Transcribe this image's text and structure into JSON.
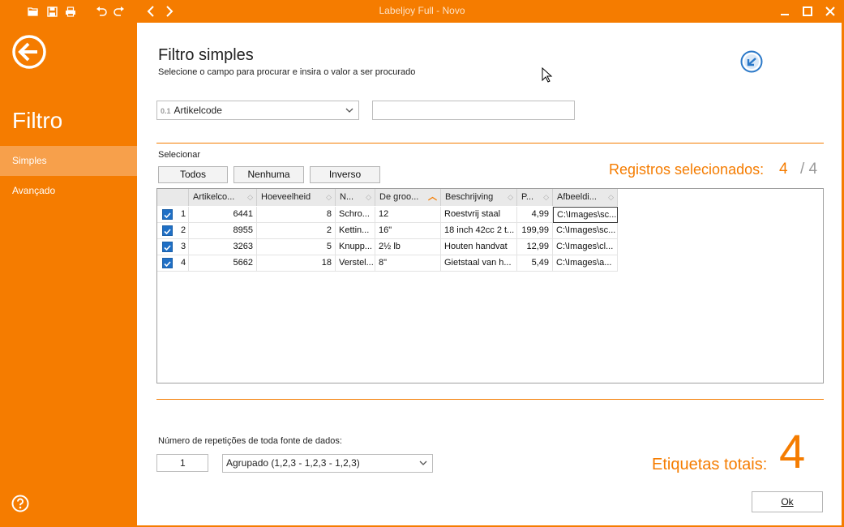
{
  "window": {
    "title": "Labeljoy Full - Novo"
  },
  "toolbar": {
    "icons": [
      "open-folder-icon",
      "save-icon",
      "print-icon",
      "undo-icon",
      "redo-icon",
      "back-icon",
      "forward-icon"
    ]
  },
  "sidebar": {
    "heading": "Filtro",
    "items": [
      {
        "label": "Simples",
        "active": true
      },
      {
        "label": "Avançado",
        "active": false
      }
    ]
  },
  "main": {
    "heading": "Filtro simples",
    "subheading": "Selecione o campo para procurar e insira o valor a ser procurado",
    "field_select": {
      "prefix": "0.1",
      "value": "Artikelcode"
    },
    "search_value": "",
    "select_label": "Selecionar",
    "buttons": {
      "all": "Todos",
      "none": "Nenhuma",
      "inverse": "Inverso"
    },
    "registros_label": "Registros selecionados:",
    "registros_selected": "4",
    "registros_total": "/ 4",
    "columns": [
      "Artikelco...",
      "Hoeveelheid",
      "N...",
      "De groo...",
      "Beschrijving",
      "P...",
      "Afbeeldi..."
    ],
    "rows": [
      {
        "n": "1",
        "code": "6441",
        "qty": "8",
        "name": "Schro...",
        "size": "12",
        "desc": "Roestvrij staal",
        "price": "4,99",
        "img": "C:\\Images\\sc...",
        "checked": true
      },
      {
        "n": "2",
        "code": "8955",
        "qty": "2",
        "name": "Kettin...",
        "size": "16\"",
        "desc": "18 inch 42cc 2 t...",
        "price": "199,99",
        "img": "C:\\Images\\sc...",
        "checked": true
      },
      {
        "n": "3",
        "code": "3263",
        "qty": "5",
        "name": "Knupp...",
        "size": "2½ lb",
        "desc": "Houten handvat",
        "price": "12,99",
        "img": "C:\\Images\\cl...",
        "checked": true
      },
      {
        "n": "4",
        "code": "5662",
        "qty": "18",
        "name": "Verstel...",
        "size": "8\"",
        "desc": "Gietstaal van h...",
        "price": "5,49",
        "img": "C:\\Images\\a...",
        "checked": true
      }
    ],
    "repeat_label": "Número de repetições de toda fonte de dados:",
    "repeat_value": "1",
    "group_select": "Agrupado (1,2,3 - 1,2,3 - 1,2,3)",
    "total_label": "Etiquetas totais:",
    "total_value": "4",
    "ok_label": "Ok"
  },
  "colors": {
    "accent": "#f57c00",
    "sidebar_active": "#f7a04b",
    "checkbox": "#1f6fc5"
  }
}
